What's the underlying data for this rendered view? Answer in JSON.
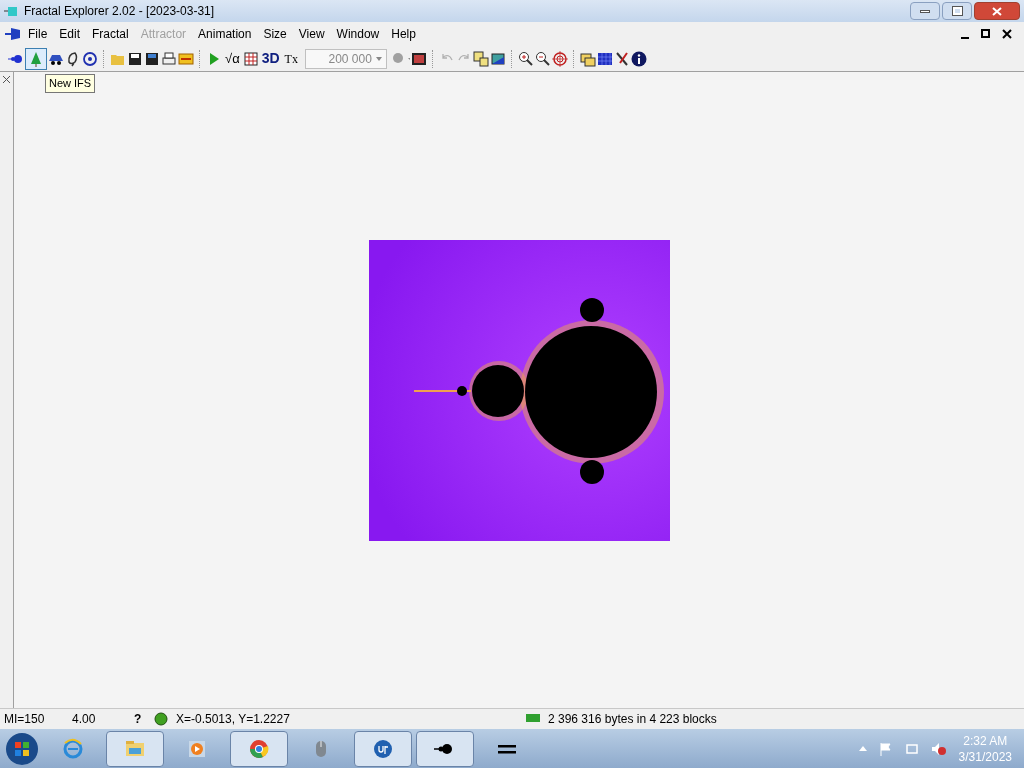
{
  "window": {
    "title": "Fractal Explorer 2.02  - [2023-03-31]"
  },
  "menu": [
    {
      "label": "File",
      "disabled": false
    },
    {
      "label": "Edit",
      "disabled": false
    },
    {
      "label": "Fractal",
      "disabled": false
    },
    {
      "label": "Attractor",
      "disabled": true
    },
    {
      "label": "Animation",
      "disabled": false
    },
    {
      "label": "Size",
      "disabled": false
    },
    {
      "label": "View",
      "disabled": false
    },
    {
      "label": "Window",
      "disabled": false
    },
    {
      "label": "Help",
      "disabled": false
    }
  ],
  "toolbar": {
    "new_ifs": {
      "hovered": true
    },
    "sqrt_label": "√α",
    "label_3d": "3D",
    "label_tx": "Tx",
    "iterations": "200 000",
    "undo": {
      "disabled": true
    },
    "redo": {
      "disabled": true
    },
    "tooltip": "New IFS"
  },
  "status_bar": {
    "max_iter": "MI=150",
    "zoom": "4.00",
    "help": "?",
    "coords": "X=-0.5013, Y=1.2227",
    "memory": "2 396 316 bytes in 4 223 blocks"
  },
  "taskbar": {
    "apps": [
      {
        "selected": false
      },
      {
        "selected": true
      },
      {
        "selected": false
      },
      {
        "selected": true
      },
      {
        "selected": false
      },
      {
        "selected": true
      },
      {
        "selected": true
      },
      {
        "selected": false
      }
    ],
    "time": "2:32 AM",
    "date": "3/31/2023"
  }
}
